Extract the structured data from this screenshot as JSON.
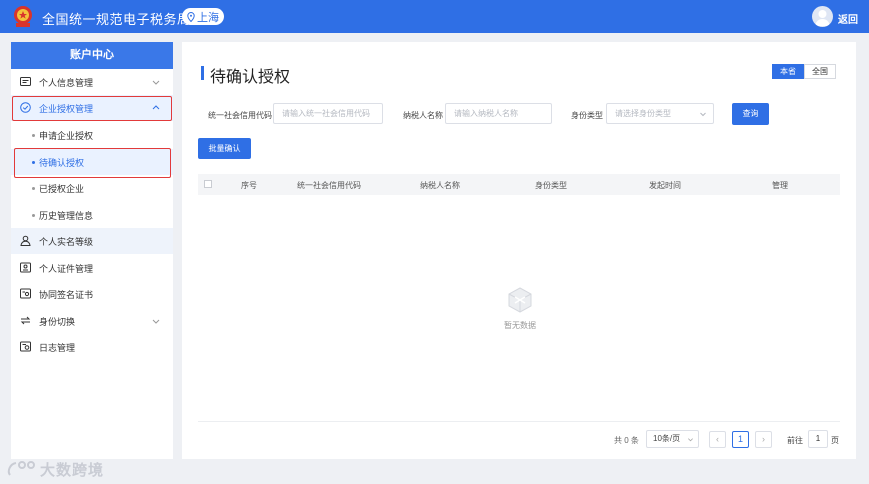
{
  "header": {
    "site_title": "全国统一规范电子税务局",
    "region": "上海",
    "back_label": "返回"
  },
  "sidebar": {
    "title": "账户中心",
    "items": {
      "personal_info": "个人信息管理",
      "enterprise_auth": "企业授权管理",
      "apply_auth": "申请企业授权",
      "pending_auth": "待确认授权",
      "authorized": "已授权企业",
      "history": "历史管理信息",
      "realname_level": "个人实名等级",
      "id_docs": "个人证件管理",
      "cosign_cert": "协同签名证书",
      "identity_switch": "身份切换",
      "log_mgmt": "日志管理"
    }
  },
  "main": {
    "title": "待确认授权",
    "scope_tabs": [
      "本省",
      "全国"
    ],
    "filters": {
      "uscc_label": "统一社会信用代码",
      "uscc_placeholder": "请输入统一社会信用代码",
      "taxpayer_label": "纳税人名称",
      "taxpayer_placeholder": "请输入纳税人名称",
      "identity_label": "身份类型",
      "identity_placeholder": "请选择身份类型",
      "query_button": "查询"
    },
    "batch_button": "批量确认",
    "columns": [
      "序号",
      "统一社会信用代码",
      "纳税人名称",
      "身份类型",
      "发起时间",
      "管理"
    ],
    "empty_text": "暂无数据",
    "pagination": {
      "total": "共 0 条",
      "page_size": "10条/页",
      "current_page": "1",
      "goto_label": "前往",
      "goto_value": "1",
      "unit": "页"
    }
  },
  "watermark": {
    "text": "大数跨境"
  },
  "colors": {
    "primary": "#2f6fe5",
    "highlight_frame": "#e23a3a"
  }
}
